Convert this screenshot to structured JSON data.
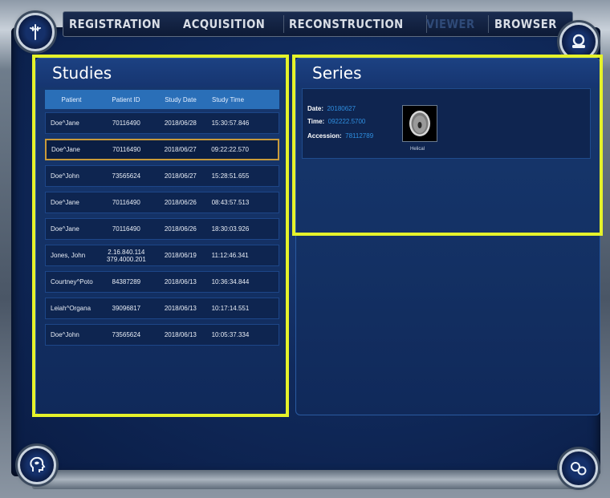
{
  "tabs": [
    {
      "label": "REGISTRATION",
      "state": "normal"
    },
    {
      "label": "ACQUISITION",
      "state": "normal"
    },
    {
      "label": "RECONSTRUCTION",
      "state": "normal"
    },
    {
      "label": "VIEWER",
      "state": "disabled"
    },
    {
      "label": "BROWSER",
      "state": "active"
    }
  ],
  "corner_icons": {
    "top_left": "tool-icon",
    "top_right": "patient-icon",
    "bottom_left": "head-profile-icon",
    "bottom_right": "settings-icon"
  },
  "studies": {
    "title": "Studies",
    "columns": [
      "Patient",
      "Patient ID",
      "Study Date",
      "Study Time"
    ],
    "rows": [
      {
        "patient": "Doe^Jane",
        "patient_id": "70116490",
        "date": "2018/06/28",
        "time": "15:30:57.846",
        "selected": false
      },
      {
        "patient": "Doe^Jane",
        "patient_id": "70116490",
        "date": "2018/06/27",
        "time": "09:22:22.570",
        "selected": true
      },
      {
        "patient": "Doe^John",
        "patient_id": "73565624",
        "date": "2018/06/27",
        "time": "15:28:51.655",
        "selected": false
      },
      {
        "patient": "Doe^Jane",
        "patient_id": "70116490",
        "date": "2018/06/26",
        "time": "08:43:57.513",
        "selected": false
      },
      {
        "patient": "Doe^Jane",
        "patient_id": "70116490",
        "date": "2018/06/26",
        "time": "18:30:03.926",
        "selected": false
      },
      {
        "patient": "Jones, John",
        "patient_id": "2.16.840.114 379.4000.201",
        "date": "2018/06/19",
        "time": "11:12:46.341",
        "selected": false
      },
      {
        "patient": "Courtney^Poto",
        "patient_id": "84387289",
        "date": "2018/06/13",
        "time": "10:36:34.844",
        "selected": false
      },
      {
        "patient": "Leiah^Organa",
        "patient_id": "39096817",
        "date": "2018/06/13",
        "time": "10:17:14.551",
        "selected": false
      },
      {
        "patient": "Doe^John",
        "patient_id": "73565624",
        "date": "2018/06/13",
        "time": "10:05:37.334",
        "selected": false
      }
    ]
  },
  "series": {
    "title": "Series",
    "date_label": "Date:",
    "date_value": "20180627",
    "time_label": "Time:",
    "time_value": "092222.5700",
    "accession_label": "Accession:",
    "accession_value": "78112789",
    "thumbnail_caption": "Helical"
  },
  "colors": {
    "highlight": "#e5f22a",
    "selected_row_border": "#c89a3a",
    "value_text": "#2f8fe0"
  }
}
